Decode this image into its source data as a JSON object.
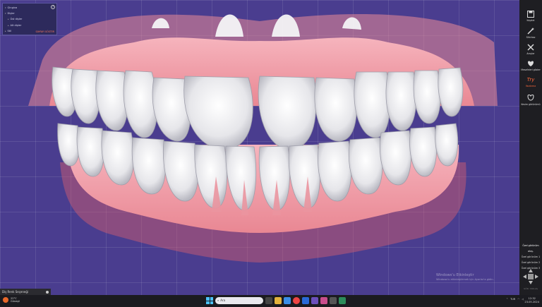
{
  "scene_tree": {
    "items": [
      {
        "label": "Gingiva",
        "arrow": "▾"
      },
      {
        "label": "Dişler",
        "arrow": "▾"
      },
      {
        "label": "Üst dişler",
        "arrow": "▸"
      },
      {
        "label": "Alt dişler",
        "arrow": "▸"
      },
      {
        "label": "Stil",
        "arrow": "▸"
      }
    ],
    "help_label": "?",
    "action_label": "SAYFAYI GÖSTER"
  },
  "toolbar": {
    "tools": [
      {
        "label": "Kaydet",
        "icon": "save-icon"
      },
      {
        "label": "Sihirbaz",
        "icon": "wizard-icon"
      },
      {
        "label": "Araçlar",
        "icon": "tools-icon"
      },
      {
        "label": "Mesafeleri göster",
        "icon": "distance-icon"
      },
      {
        "label": "Yazdırma",
        "icon": "try-icon",
        "glyph": "Try"
      },
      {
        "label": "Kesim görünümü",
        "icon": "tooth-section-icon"
      }
    ],
    "views_title": "Özel görünüm oluş.",
    "views": [
      "Özel görünüm 1",
      "Özel görünüm 2",
      "Özel görünüm 3"
    ],
    "navpad_label": "GÖR. YAKLAŞ"
  },
  "watermark": {
    "line1": "Windows'u Etkinleştir",
    "line2": "Windows'u etkinleştirmek için Ayarlar'a gidin."
  },
  "bottom_panel": {
    "title": "Diş Renk Seçeneği"
  },
  "taskbar": {
    "weather_temp": "22°C",
    "weather_cond": "Güneşli",
    "search_placeholder": "Ara",
    "time": "12:32",
    "date": "23.05.2024",
    "lang": "TUR"
  },
  "colors": {
    "viewport_bg": "#4a3d8f",
    "gum": "#f0a3ae",
    "tooth": "#f2f2f4",
    "accent": "#ff6a3d"
  }
}
